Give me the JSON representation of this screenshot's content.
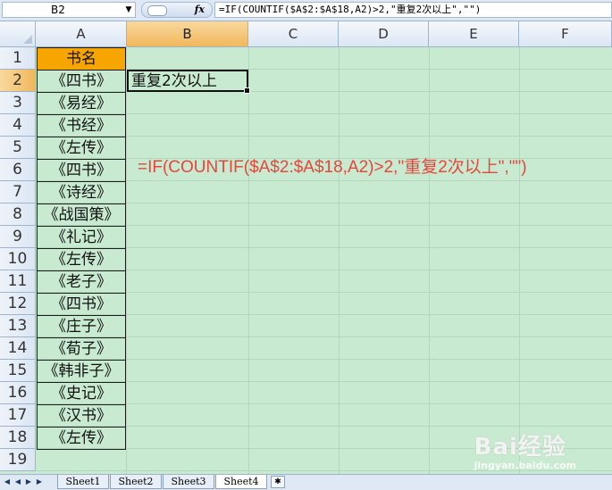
{
  "formula_bar": {
    "name_box": "B2",
    "fx_label": "fx",
    "formula": "=IF(COUNTIF($A$2:$A$18,A2)>2,\"重复2次以上\",\"\")"
  },
  "columns": [
    "A",
    "B",
    "C",
    "D",
    "E",
    "F"
  ],
  "rows": [
    "1",
    "2",
    "3",
    "4",
    "5",
    "6",
    "7",
    "8",
    "9",
    "10",
    "11",
    "12",
    "13",
    "14",
    "15",
    "16",
    "17",
    "18",
    "19"
  ],
  "cells": {
    "A": [
      "书名",
      "《四书》",
      "《易经》",
      "《书经》",
      "《左传》",
      "《四书》",
      "《诗经》",
      "《战国策》",
      "《礼记》",
      "《左传》",
      "《老子》",
      "《四书》",
      "《庄子》",
      "《荀子》",
      "《韩非子》",
      "《史记》",
      "《汉书》",
      "《左传》"
    ],
    "B2": "重复2次以上"
  },
  "annotation": "=IF(COUNTIF($A$2:$A$18,A2)>2,\"重复2次以上\",\"\")",
  "sheet_tabs": [
    "Sheet1",
    "Sheet2",
    "Sheet3",
    "Sheet4"
  ],
  "active_tab": "Sheet4",
  "watermark": {
    "brand": "Bai经验",
    "url": "jingyan.baidu.com"
  },
  "colors": {
    "header_fill": "#f7a500",
    "annotation": "#e8463a",
    "sheet_bg": "#c8ead0"
  }
}
